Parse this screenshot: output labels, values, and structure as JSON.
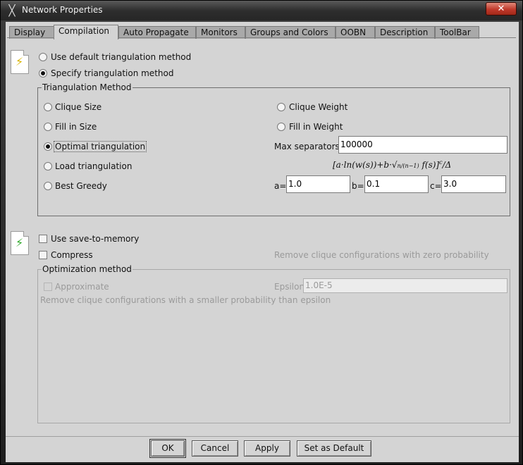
{
  "window": {
    "title": "Network Properties",
    "close_label": "✕"
  },
  "tabs": [
    "Display",
    "Compilation",
    "Auto Propagate",
    "Monitors",
    "Groups and Colors",
    "OOBN",
    "Description",
    "ToolBar"
  ],
  "triangulation": {
    "use_default_label": "Use default triangulation method",
    "specify_label": "Specify triangulation method",
    "selected": "specify",
    "group_title": "Triangulation Method",
    "methods": {
      "clique_size": "Clique Size",
      "clique_weight": "Clique Weight",
      "fill_in_size": "Fill in Size",
      "fill_in_weight": "Fill in Weight",
      "optimal": "Optimal triangulation",
      "load": "Load triangulation",
      "best_greedy": "Best Greedy"
    },
    "selected_method": "optimal",
    "max_separators_label": "Max separators",
    "max_separators_value": "100000",
    "a_label": "a=",
    "a_value": "1.0",
    "b_label": "b=",
    "b_value": "0.1",
    "c_label": "c=",
    "c_value": "3.0"
  },
  "memory": {
    "save_to_memory_label": "Use save-to-memory",
    "compress_label": "Compress",
    "zero_prob_note": "Remove clique configurations with zero probability"
  },
  "optimization": {
    "group_title": "Optimization method",
    "approximate_label": "Approximate",
    "epsilon_label": "Epsilon",
    "epsilon_value": "1.0E-5",
    "note": "Remove clique configurations with a smaller probability than epsilon"
  },
  "buttons": {
    "ok": "OK",
    "cancel": "Cancel",
    "apply": "Apply",
    "set_default": "Set as Default"
  },
  "icons": {
    "app": "x-logo-icon",
    "compile": "lightning-icon",
    "memory": "lightning-icon"
  }
}
